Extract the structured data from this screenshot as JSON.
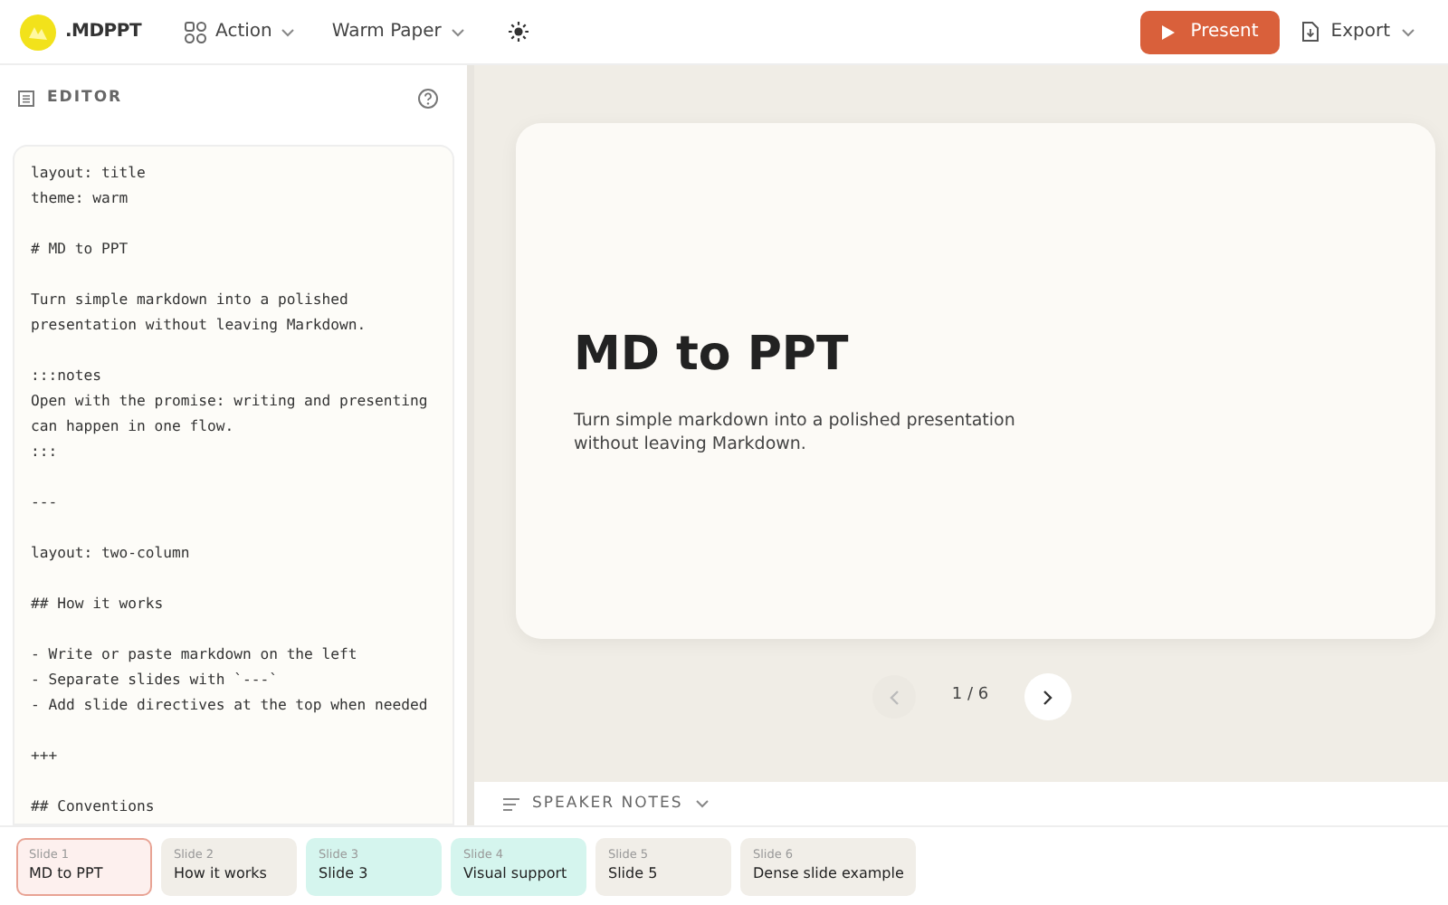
{
  "header": {
    "logo": ".MDPPT",
    "menus": [
      {
        "kind": "icon-menu",
        "label": "Action"
      },
      {
        "kind": "menu",
        "label": "Warm Paper"
      }
    ],
    "present": "Present",
    "export": "Export"
  },
  "editor": {
    "title": "EDITOR",
    "blocks": [
      [
        "layout: title",
        "theme: warm"
      ],
      [
        "# MD to PPT"
      ],
      [
        "Turn simple markdown into a polished",
        "presentation without leaving Markdown."
      ],
      [
        ":::notes",
        "Open with the promise: writing and presenting",
        "can happen in one flow.",
        ":::"
      ],
      [
        "---"
      ],
      [
        "layout: two-column"
      ],
      [
        "## How it works"
      ],
      [
        "- Write or paste markdown on the left",
        "- Separate slides with `---`",
        "- Add slide directives at the top when needed"
      ],
      [
        "+++"
      ],
      [
        "## Conventions"
      ]
    ]
  },
  "slide": {
    "title": "MD to PPT",
    "subtitle": "Turn simple markdown into a polished presentation without leaving Markdown."
  },
  "pager": {
    "text": "1 / 6",
    "prev_disabled": true
  },
  "speaker_notes": {
    "label": "SPEAKER NOTES",
    "expanded": false
  },
  "thumbnails": [
    {
      "number": "Slide 1",
      "title": "MD to PPT",
      "selected": true,
      "color": "#fdf0ee"
    },
    {
      "number": "Slide 2",
      "title": "How it works",
      "selected": false,
      "color": "#f1eee8"
    },
    {
      "number": "Slide 3",
      "title": "Slide 3",
      "selected": false,
      "color": "#d5f5ee"
    },
    {
      "number": "Slide 4",
      "title": "Visual support",
      "selected": false,
      "color": "#d5f5ee"
    },
    {
      "number": "Slide 5",
      "title": "Slide 5",
      "selected": false,
      "color": "#f1eee8"
    },
    {
      "number": "Slide 6",
      "title": "Dense slide example",
      "selected": false,
      "color": "#f1eee8"
    }
  ]
}
